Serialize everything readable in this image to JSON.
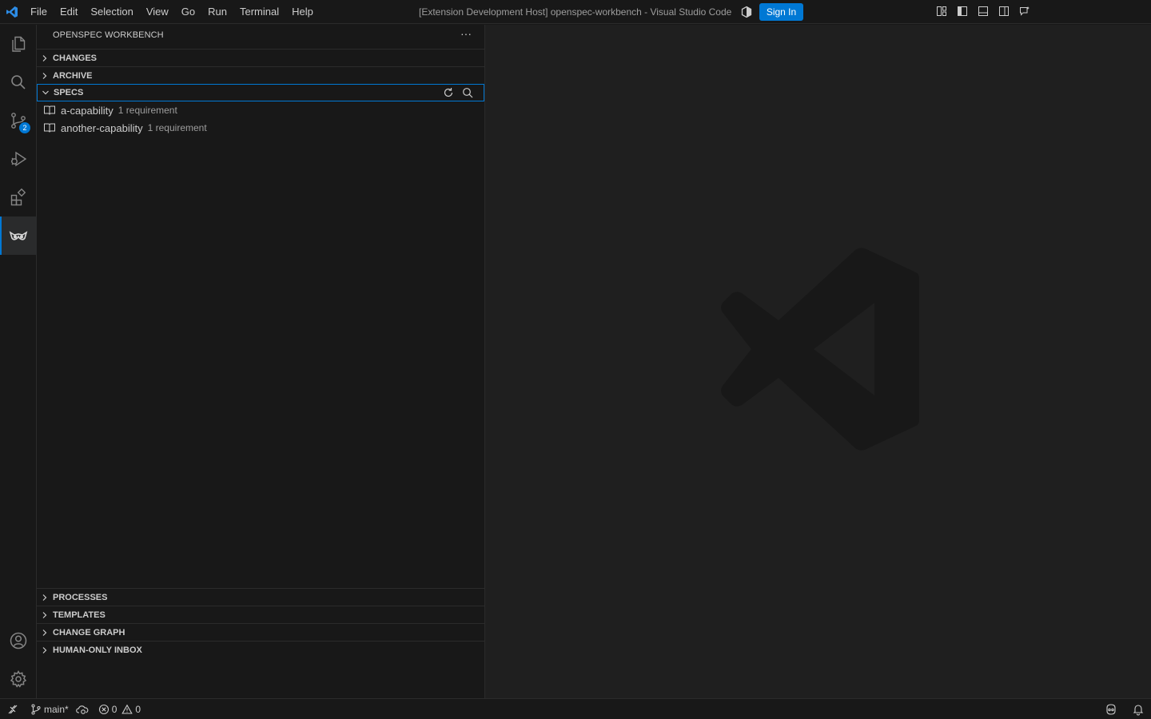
{
  "titlebar": {
    "menu": [
      "File",
      "Edit",
      "Selection",
      "View",
      "Go",
      "Run",
      "Terminal",
      "Help"
    ],
    "window_title": "[Extension Development Host] openspec-workbench - Visual Studio Code",
    "sign_in_label": "Sign In"
  },
  "activitybar": {
    "items": [
      "explorer",
      "search",
      "source-control",
      "run-and-debug",
      "extensions",
      "openspec-workbench"
    ],
    "source_control_badge": "2",
    "bottom_items": [
      "accounts",
      "manage"
    ]
  },
  "sidebar": {
    "title": "OPENSPEC WORKBENCH",
    "more_label": "···",
    "sections": {
      "changes": "CHANGES",
      "archive": "ARCHIVE",
      "specs": "SPECS",
      "processes": "PROCESSES",
      "templates": "TEMPLATES",
      "change_graph": "CHANGE GRAPH",
      "human_inbox": "HUMAN-ONLY INBOX"
    },
    "specs": [
      {
        "name": "a-capability",
        "description": "1 requirement"
      },
      {
        "name": "another-capability",
        "description": "1 requirement"
      }
    ]
  },
  "statusbar": {
    "branch": "main*",
    "errors": "0",
    "warnings": "0"
  },
  "colors": {
    "accent": "#0078d4",
    "background": "#181818",
    "editor_background": "#1f1f1f"
  }
}
